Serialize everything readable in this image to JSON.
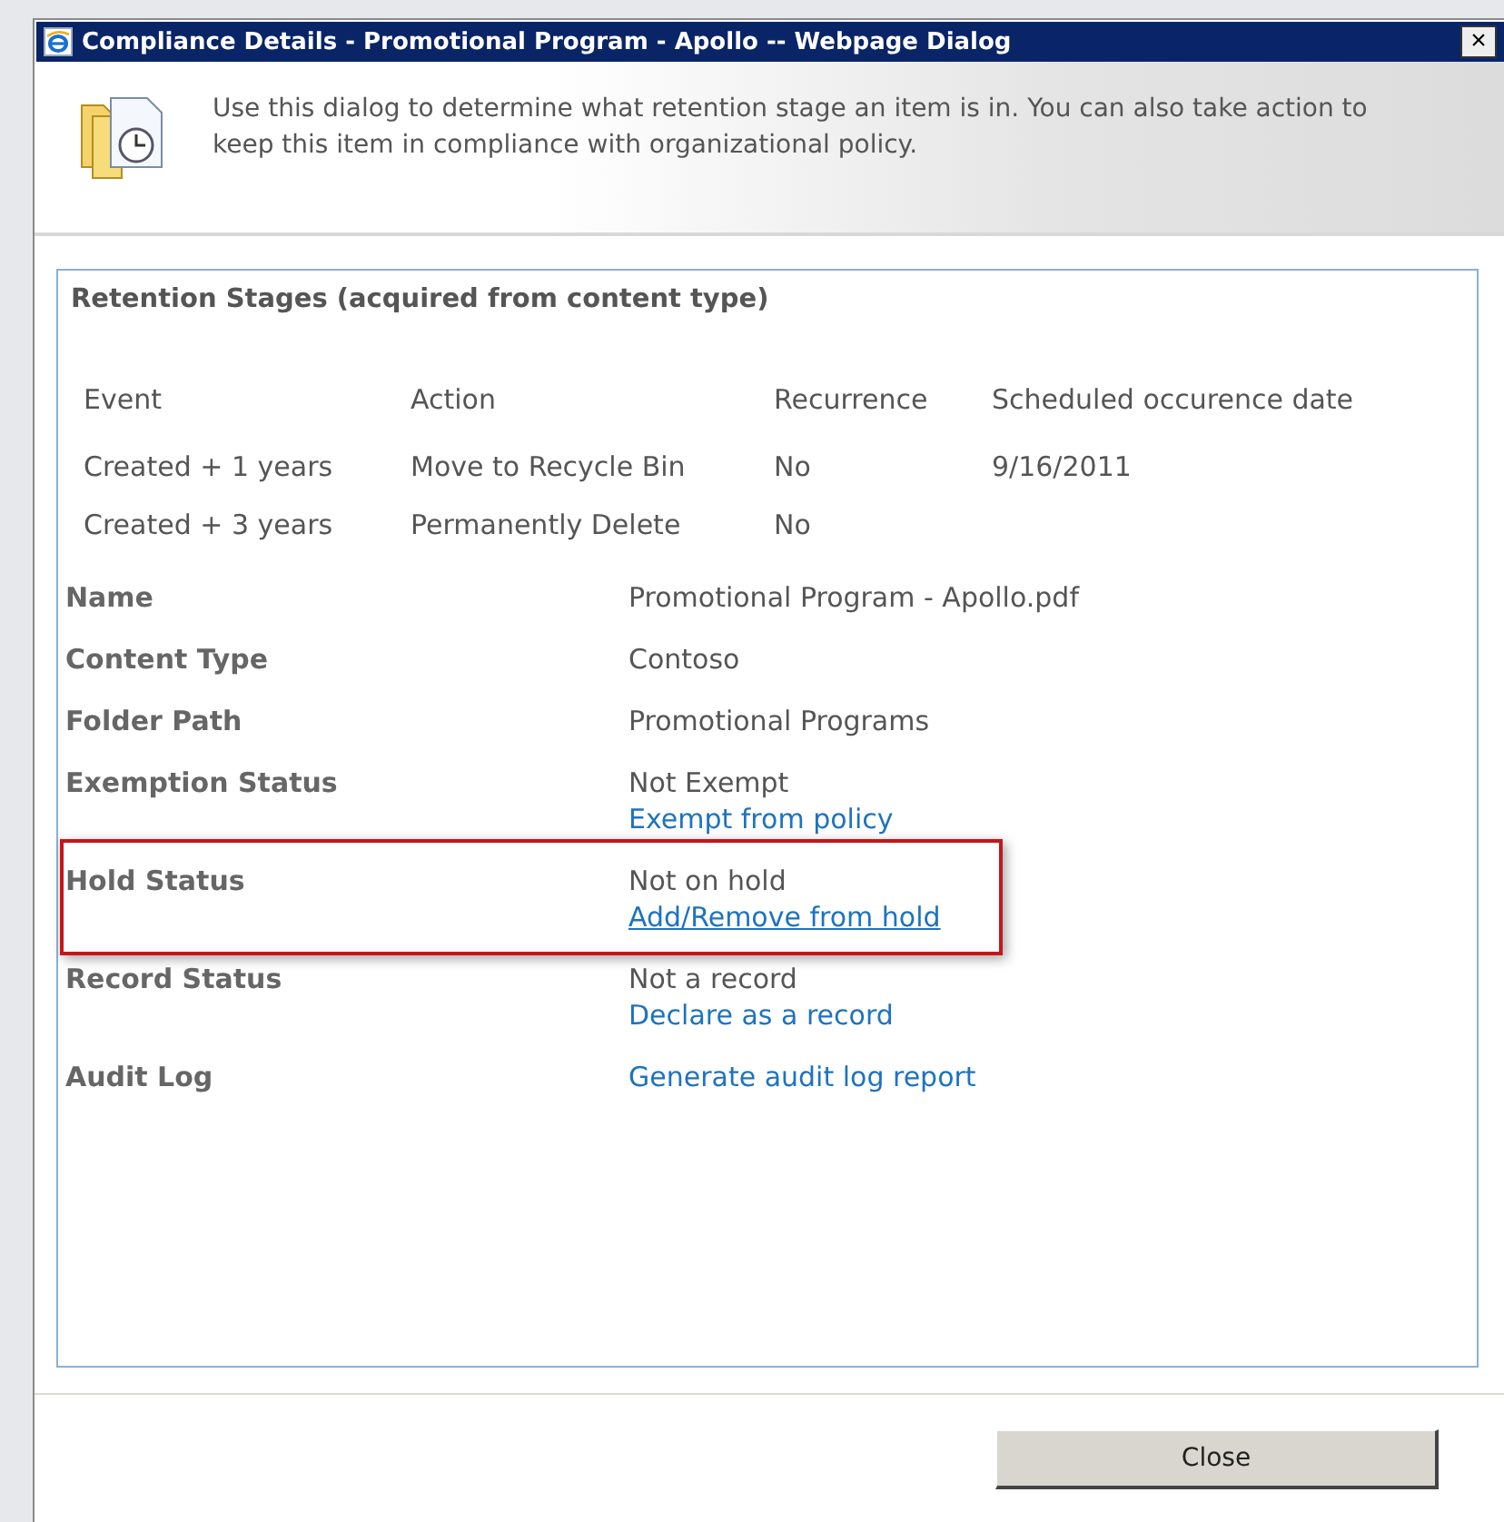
{
  "window": {
    "title": "Compliance Details - Promotional Program - Apollo -- Webpage Dialog",
    "close": "×"
  },
  "intro": "Use this dialog to determine what retention stage an item is in. You can also take action to keep this item in compliance with organizational policy.",
  "retention": {
    "title": "Retention Stages (acquired from content type)",
    "columns": [
      "Event",
      "Action",
      "Recurrence",
      "Scheduled occurence date"
    ],
    "rows": [
      [
        "Created + 1 years",
        "Move to Recycle Bin",
        "No",
        "9/16/2011"
      ],
      [
        "Created + 3 years",
        "Permanently Delete",
        "No"
      ]
    ]
  },
  "properties": [
    {
      "label": "Name",
      "value": "Promotional Program - Apollo.pdf",
      "highlighted": false
    },
    {
      "label": "Content Type",
      "value": "Contoso",
      "highlighted": false
    },
    {
      "label": "Folder Path",
      "value": "Promotional Programs",
      "highlighted": false
    },
    {
      "label": "Exemption Status",
      "value": "Not Exempt",
      "link": "Exempt from policy",
      "highlighted": false
    },
    {
      "label": "Hold Status",
      "value": "Not on hold",
      "link": "Add/Remove from hold",
      "highlighted": true
    },
    {
      "label": "Record Status",
      "value": "Not a record",
      "link": "Declare as a record",
      "highlighted": false
    },
    {
      "label": "Audit Log",
      "link": "Generate audit log report",
      "highlighted": false
    }
  ],
  "buttons": [
    "Close"
  ]
}
